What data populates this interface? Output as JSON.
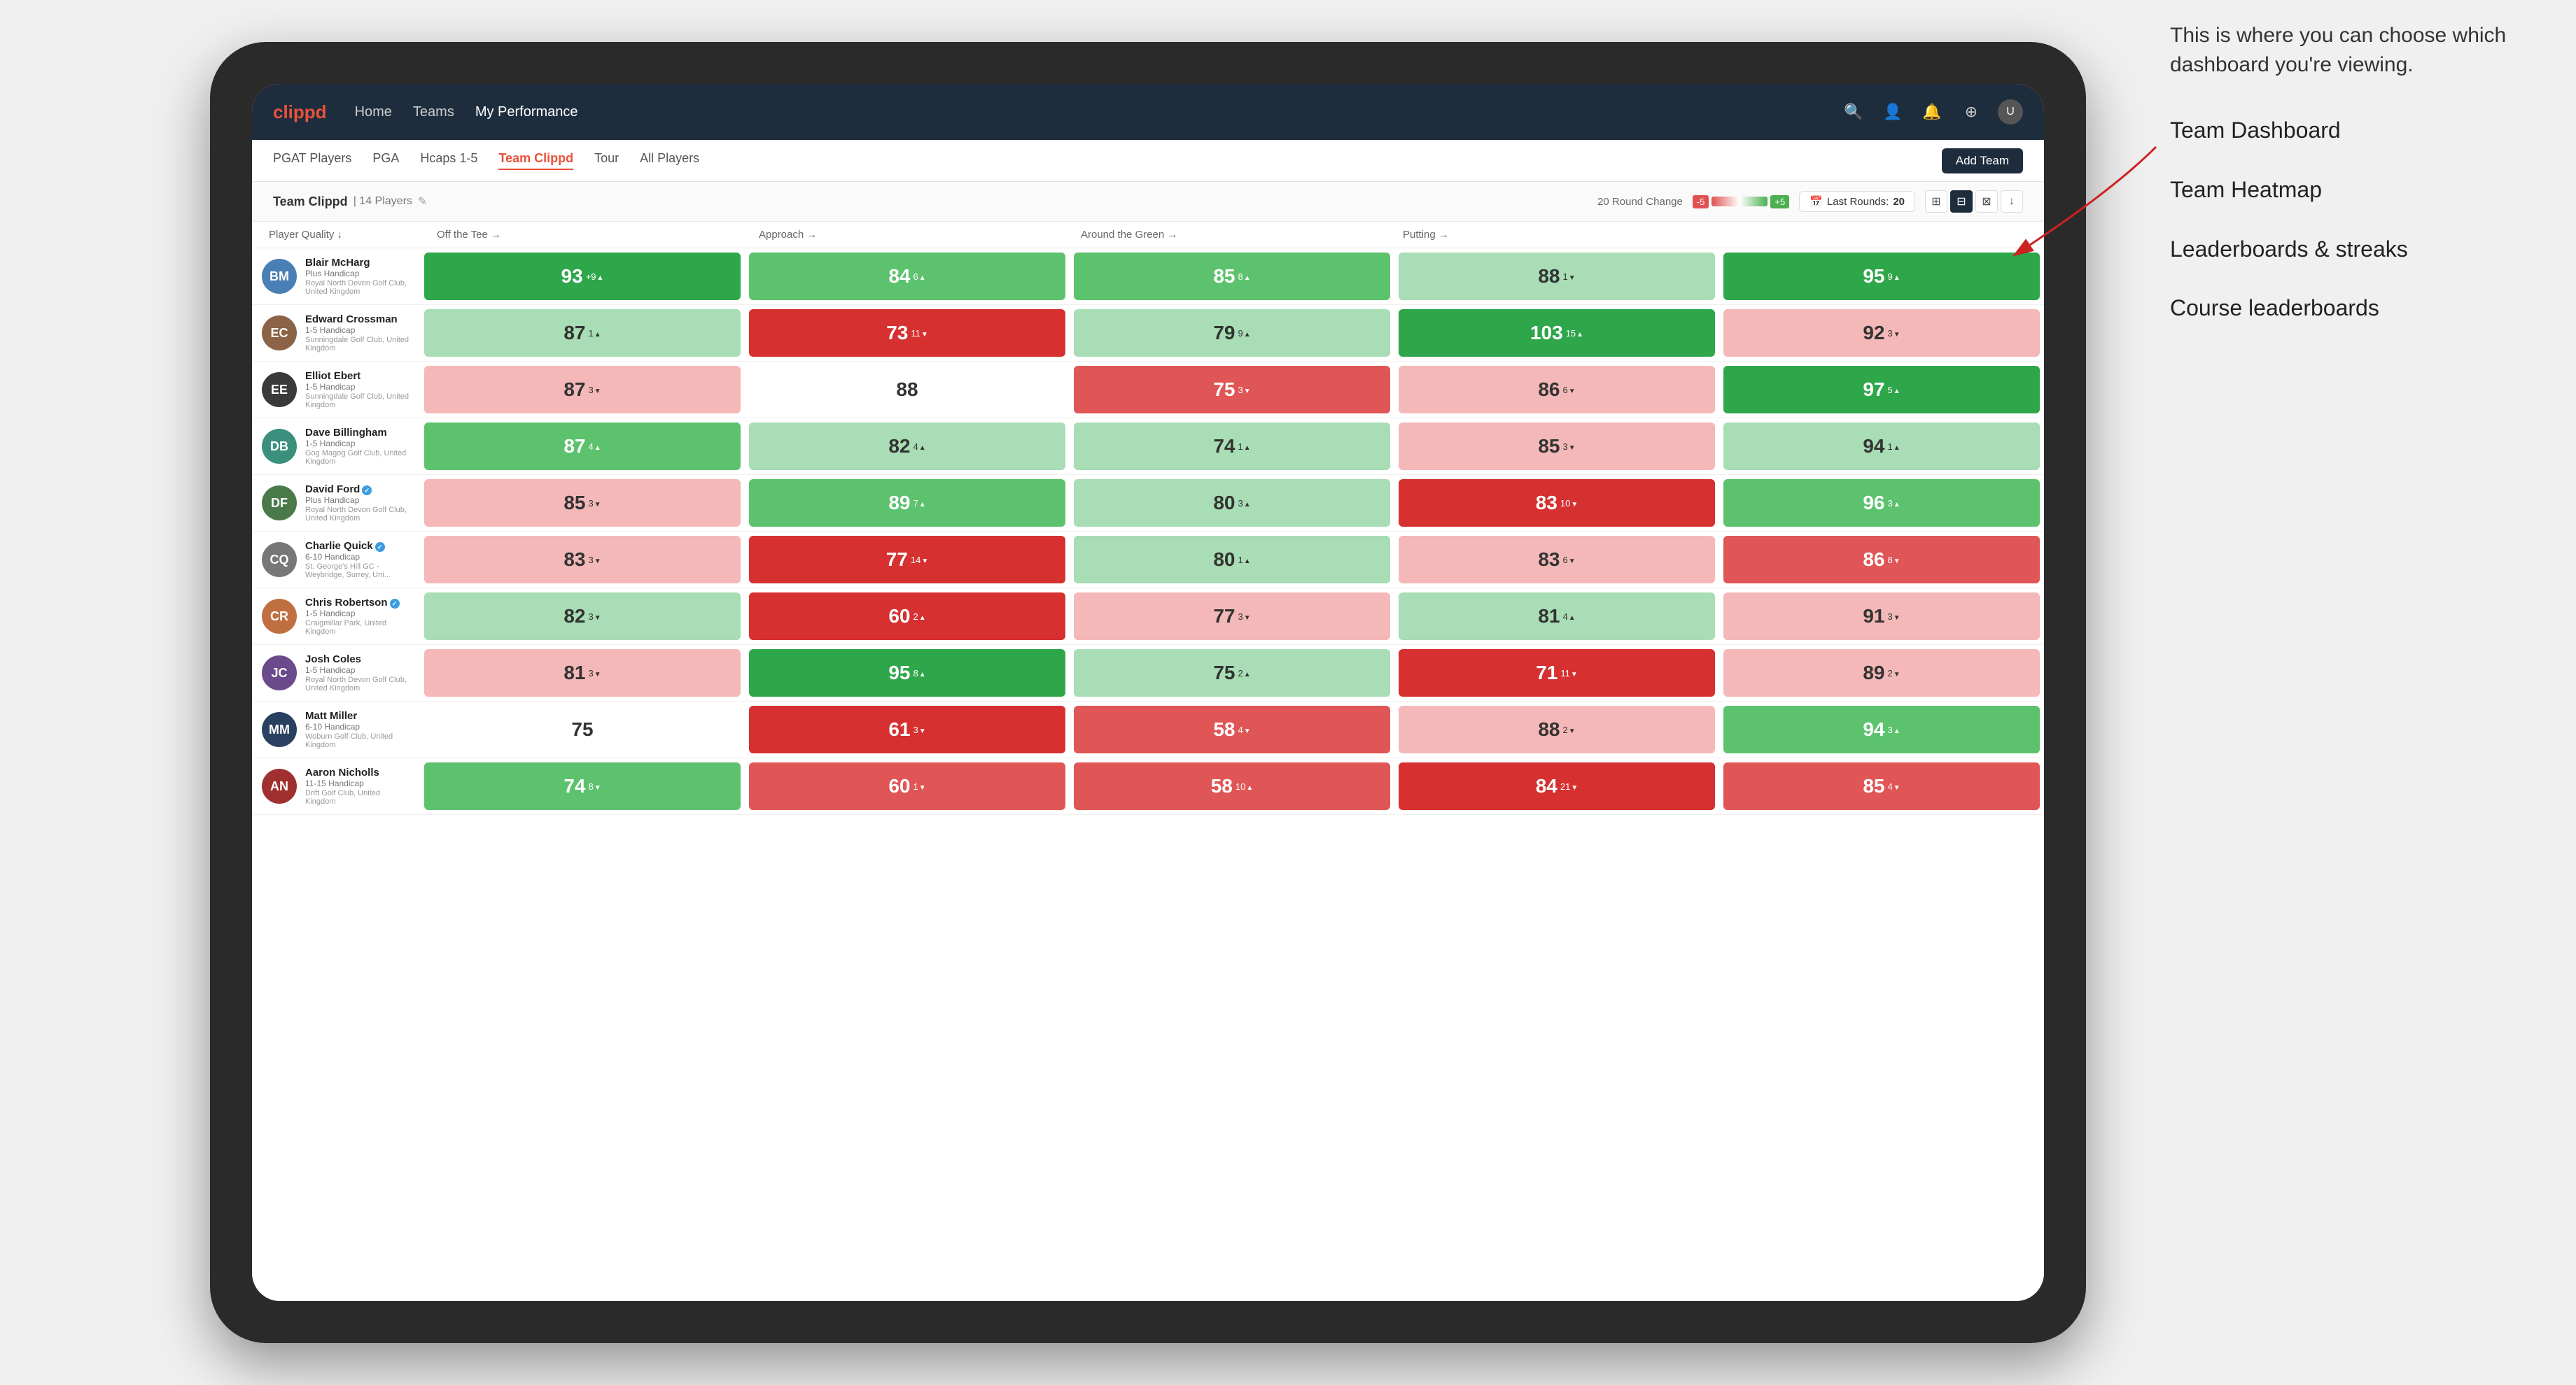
{
  "annotation": {
    "description": "This is where you can choose which dashboard you're viewing.",
    "items": [
      "Team Dashboard",
      "Team Heatmap",
      "Leaderboards & streaks",
      "Course leaderboards"
    ]
  },
  "nav": {
    "logo": "clippd",
    "links": [
      "Home",
      "Teams",
      "My Performance"
    ],
    "active_link": "My Performance",
    "icons": [
      "🔍",
      "👤",
      "🔔",
      "⊕",
      "👤"
    ]
  },
  "sub_nav": {
    "links": [
      "PGAT Players",
      "PGA",
      "Hcaps 1-5",
      "Team Clippd",
      "Tour",
      "All Players"
    ],
    "active_link": "Team Clippd",
    "add_button": "Add Team"
  },
  "team_header": {
    "name": "Team Clippd",
    "count": "14 Players",
    "round_change": "20 Round Change",
    "scale_negative": "-5",
    "scale_positive": "+5",
    "last_rounds_label": "Last Rounds:",
    "last_rounds_value": "20"
  },
  "table": {
    "columns": [
      "Player Quality ↓",
      "Off the Tee →",
      "Approach →",
      "Around the Green →",
      "Putting →"
    ],
    "players": [
      {
        "name": "Blair McHarg",
        "handicap": "Plus Handicap",
        "club": "Royal North Devon Golf Club, United Kingdom",
        "avatar_color": "av-blue",
        "avatar_initials": "BM",
        "stats": [
          {
            "value": "93",
            "change": "+9",
            "direction": "up",
            "color": "bg-green-strong"
          },
          {
            "value": "84",
            "change": "6",
            "direction": "up",
            "color": "bg-green-med"
          },
          {
            "value": "85",
            "change": "8",
            "direction": "up",
            "color": "bg-green-med"
          },
          {
            "value": "88",
            "change": "-1",
            "direction": "down",
            "color": "bg-green-light"
          },
          {
            "value": "95",
            "change": "9",
            "direction": "up",
            "color": "bg-green-strong"
          }
        ]
      },
      {
        "name": "Edward Crossman",
        "handicap": "1-5 Handicap",
        "club": "Sunningdale Golf Club, United Kingdom",
        "avatar_color": "av-brown",
        "avatar_initials": "EC",
        "stats": [
          {
            "value": "87",
            "change": "1",
            "direction": "up",
            "color": "bg-green-light"
          },
          {
            "value": "73",
            "change": "-11",
            "direction": "down",
            "color": "bg-red-strong"
          },
          {
            "value": "79",
            "change": "9",
            "direction": "up",
            "color": "bg-green-light"
          },
          {
            "value": "103",
            "change": "15",
            "direction": "up",
            "color": "bg-green-strong"
          },
          {
            "value": "92",
            "change": "-3",
            "direction": "down",
            "color": "bg-red-light"
          }
        ]
      },
      {
        "name": "Elliot Ebert",
        "handicap": "1-5 Handicap",
        "club": "Sunningdale Golf Club, United Kingdom",
        "avatar_color": "av-dark",
        "avatar_initials": "EE",
        "stats": [
          {
            "value": "87",
            "change": "-3",
            "direction": "down",
            "color": "bg-red-light"
          },
          {
            "value": "88",
            "change": "",
            "direction": "",
            "color": "bg-white"
          },
          {
            "value": "75",
            "change": "-3",
            "direction": "down",
            "color": "bg-red-med"
          },
          {
            "value": "86",
            "change": "-6",
            "direction": "down",
            "color": "bg-red-light"
          },
          {
            "value": "97",
            "change": "5",
            "direction": "up",
            "color": "bg-green-strong"
          }
        ]
      },
      {
        "name": "Dave Billingham",
        "handicap": "1-5 Handicap",
        "club": "Gog Magog Golf Club, United Kingdom",
        "avatar_color": "av-teal",
        "avatar_initials": "DB",
        "stats": [
          {
            "value": "87",
            "change": "4",
            "direction": "up",
            "color": "bg-green-med"
          },
          {
            "value": "82",
            "change": "4",
            "direction": "up",
            "color": "bg-green-light"
          },
          {
            "value": "74",
            "change": "1",
            "direction": "up",
            "color": "bg-green-light"
          },
          {
            "value": "85",
            "change": "-3",
            "direction": "down",
            "color": "bg-red-light"
          },
          {
            "value": "94",
            "change": "1",
            "direction": "up",
            "color": "bg-green-light"
          }
        ]
      },
      {
        "name": "David Ford",
        "handicap": "Plus Handicap",
        "club": "Royal North Devon Golf Club, United Kingdom",
        "avatar_color": "av-green",
        "avatar_initials": "DF",
        "verified": true,
        "stats": [
          {
            "value": "85",
            "change": "-3",
            "direction": "down",
            "color": "bg-red-light"
          },
          {
            "value": "89",
            "change": "7",
            "direction": "up",
            "color": "bg-green-med"
          },
          {
            "value": "80",
            "change": "3",
            "direction": "up",
            "color": "bg-green-light"
          },
          {
            "value": "83",
            "change": "-10",
            "direction": "down",
            "color": "bg-red-strong"
          },
          {
            "value": "96",
            "change": "3",
            "direction": "up",
            "color": "bg-green-med"
          }
        ]
      },
      {
        "name": "Charlie Quick",
        "handicap": "6-10 Handicap",
        "club": "St. George's Hill GC - Weybridge, Surrey, Uni...",
        "avatar_color": "av-gray",
        "avatar_initials": "CQ",
        "verified": true,
        "stats": [
          {
            "value": "83",
            "change": "-3",
            "direction": "down",
            "color": "bg-red-light"
          },
          {
            "value": "77",
            "change": "-14",
            "direction": "down",
            "color": "bg-red-strong"
          },
          {
            "value": "80",
            "change": "1",
            "direction": "up",
            "color": "bg-green-light"
          },
          {
            "value": "83",
            "change": "-6",
            "direction": "down",
            "color": "bg-red-light"
          },
          {
            "value": "86",
            "change": "-8",
            "direction": "down",
            "color": "bg-red-med"
          }
        ]
      },
      {
        "name": "Chris Robertson",
        "handicap": "1-5 Handicap",
        "club": "Craigmillar Park, United Kingdom",
        "avatar_color": "av-orange",
        "avatar_initials": "CR",
        "verified": true,
        "stats": [
          {
            "value": "82",
            "change": "-3",
            "direction": "down",
            "color": "bg-green-light"
          },
          {
            "value": "60",
            "change": "2",
            "direction": "up",
            "color": "bg-red-strong"
          },
          {
            "value": "77",
            "change": "-3",
            "direction": "down",
            "color": "bg-red-light"
          },
          {
            "value": "81",
            "change": "4",
            "direction": "up",
            "color": "bg-green-light"
          },
          {
            "value": "91",
            "change": "-3",
            "direction": "down",
            "color": "bg-red-light"
          }
        ]
      },
      {
        "name": "Josh Coles",
        "handicap": "1-5 Handicap",
        "club": "Royal North Devon Golf Club, United Kingdom",
        "avatar_color": "av-purple",
        "avatar_initials": "JC",
        "stats": [
          {
            "value": "81",
            "change": "-3",
            "direction": "down",
            "color": "bg-red-light"
          },
          {
            "value": "95",
            "change": "8",
            "direction": "up",
            "color": "bg-green-strong"
          },
          {
            "value": "75",
            "change": "2",
            "direction": "up",
            "color": "bg-green-light"
          },
          {
            "value": "71",
            "change": "-11",
            "direction": "down",
            "color": "bg-red-strong"
          },
          {
            "value": "89",
            "change": "-2",
            "direction": "down",
            "color": "bg-red-light"
          }
        ]
      },
      {
        "name": "Matt Miller",
        "handicap": "6-10 Handicap",
        "club": "Woburn Golf Club, United Kingdom",
        "avatar_color": "av-navy",
        "avatar_initials": "MM",
        "stats": [
          {
            "value": "75",
            "change": "",
            "direction": "",
            "color": "bg-white"
          },
          {
            "value": "61",
            "change": "-3",
            "direction": "down",
            "color": "bg-red-strong"
          },
          {
            "value": "58",
            "change": "-4",
            "direction": "down",
            "color": "bg-red-med"
          },
          {
            "value": "88",
            "change": "-2",
            "direction": "down",
            "color": "bg-red-light"
          },
          {
            "value": "94",
            "change": "3",
            "direction": "up",
            "color": "bg-green-med"
          }
        ]
      },
      {
        "name": "Aaron Nicholls",
        "handicap": "11-15 Handicap",
        "club": "Drift Golf Club, United Kingdom",
        "avatar_color": "av-red",
        "avatar_initials": "AN",
        "stats": [
          {
            "value": "74",
            "change": "-8",
            "direction": "down",
            "color": "bg-green-med"
          },
          {
            "value": "60",
            "change": "-1",
            "direction": "down",
            "color": "bg-red-med"
          },
          {
            "value": "58",
            "change": "10",
            "direction": "up",
            "color": "bg-red-med"
          },
          {
            "value": "84",
            "change": "-21",
            "direction": "down",
            "color": "bg-red-strong"
          },
          {
            "value": "85",
            "change": "-4",
            "direction": "down",
            "color": "bg-red-med"
          }
        ]
      }
    ]
  }
}
